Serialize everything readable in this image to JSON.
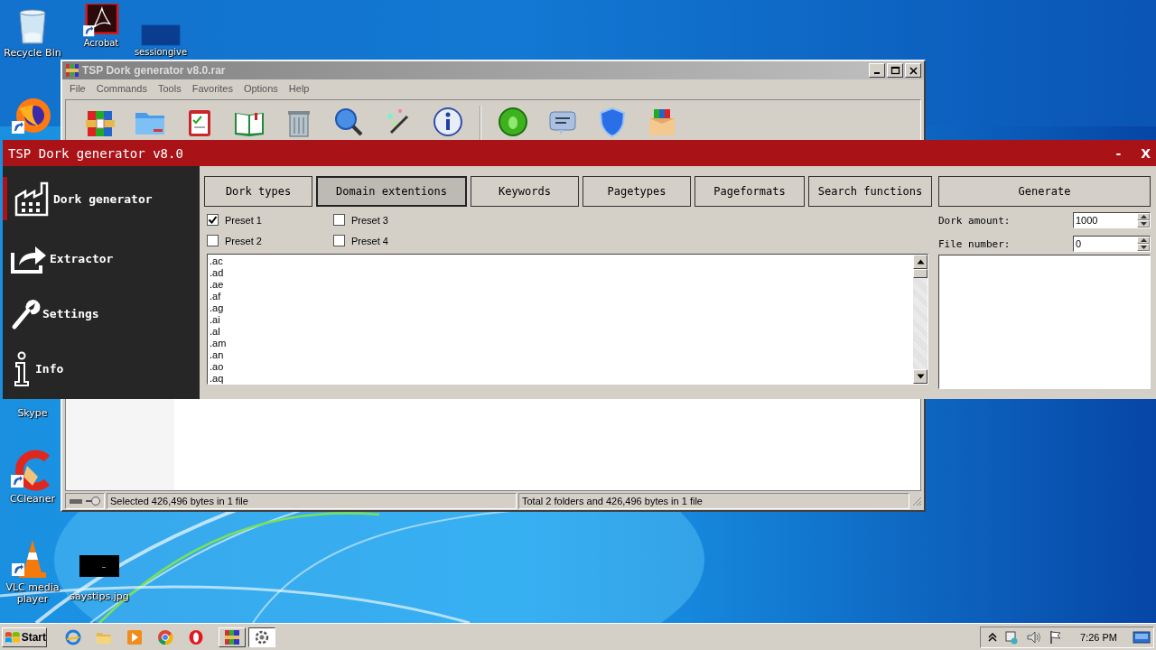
{
  "desktop_icons": [
    {
      "label": "Recycle Bin"
    },
    {
      "label": "Acrobat"
    },
    {
      "label": "sessiongive"
    },
    {
      "label": "Skype"
    },
    {
      "label": "CCleaner"
    },
    {
      "label": "VLC media player"
    },
    {
      "label": "saystips.jpg"
    }
  ],
  "archive_window": {
    "title": "TSP Dork generator v8.0.rar",
    "menu": [
      "File",
      "Commands",
      "Tools",
      "Favorites",
      "Options",
      "Help"
    ],
    "status_bar": [
      "Selected 426,496 bytes in 1 file",
      "Total 2 folders and 426,496 bytes in 1 file"
    ]
  },
  "dork_window": {
    "title": "TSP Dork generator v8.0",
    "window_buttons": [
      "-",
      "X"
    ],
    "sidebar": [
      {
        "label": "Dork generator",
        "selected": true
      },
      {
        "label": "Extractor",
        "selected": false
      },
      {
        "label": "Settings",
        "selected": false
      },
      {
        "label": "Info",
        "selected": false
      }
    ],
    "tabs": [
      {
        "label": "Dork types",
        "selected": false
      },
      {
        "label": "Domain extentions",
        "selected": true
      },
      {
        "label": "Keywords",
        "selected": false
      },
      {
        "label": "Pagetypes",
        "selected": false
      },
      {
        "label": "Pageformats",
        "selected": false
      },
      {
        "label": "Search functions",
        "selected": false
      }
    ],
    "presets": [
      {
        "label": "Preset 1",
        "checked": true
      },
      {
        "label": "Preset 3",
        "checked": false
      },
      {
        "label": "Preset 2",
        "checked": false
      },
      {
        "label": "Preset 4",
        "checked": false
      }
    ],
    "extensions": [
      ".ac",
      ".ad",
      ".ae",
      ".af",
      ".ag",
      ".ai",
      ".al",
      ".am",
      ".an",
      ".ao",
      ".aq"
    ],
    "generate_button": "Generate",
    "fields": [
      {
        "label": "Dork amount:",
        "value": "1000"
      },
      {
        "label": "File number:",
        "value": "0"
      }
    ]
  },
  "taskbar": {
    "start": "Start",
    "tasks": [
      {
        "selected": false
      },
      {
        "selected": true
      }
    ],
    "clock": "7:26 PM"
  }
}
